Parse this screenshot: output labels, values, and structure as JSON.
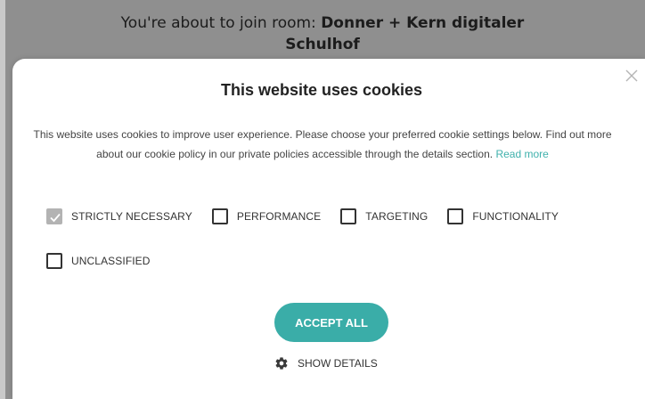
{
  "background": {
    "banner_prefix": "You're about to join room: ",
    "room_name_line1": "Donner + Kern digitaler",
    "room_name_line2": "Schulhof"
  },
  "cookie_modal": {
    "title": "This website uses cookies",
    "description": "This website uses cookies to improve user experience. Please choose your preferred cookie settings below. Find out more about our cookie policy in our private policies accessible through the details section. ",
    "read_more_label": "Read more",
    "options": [
      {
        "label": "STRICTLY NECESSARY",
        "checked": true,
        "disabled": true
      },
      {
        "label": "PERFORMANCE",
        "checked": false,
        "disabled": false
      },
      {
        "label": "TARGETING",
        "checked": false,
        "disabled": false
      },
      {
        "label": "FUNCTIONALITY",
        "checked": false,
        "disabled": false
      },
      {
        "label": "UNCLASSIFIED",
        "checked": false,
        "disabled": false
      }
    ],
    "accept_all_label": "ACCEPT ALL",
    "show_details_label": "SHOW DETAILS",
    "icons": {
      "close": "close-icon",
      "settings": "gear-icon",
      "check": "checkmark-icon"
    }
  },
  "colors": {
    "accent": "#3aada8",
    "link": "#3fb1ac",
    "overlay": "#8f8f8f",
    "disabled_checkbox": "#b3b3b3"
  }
}
